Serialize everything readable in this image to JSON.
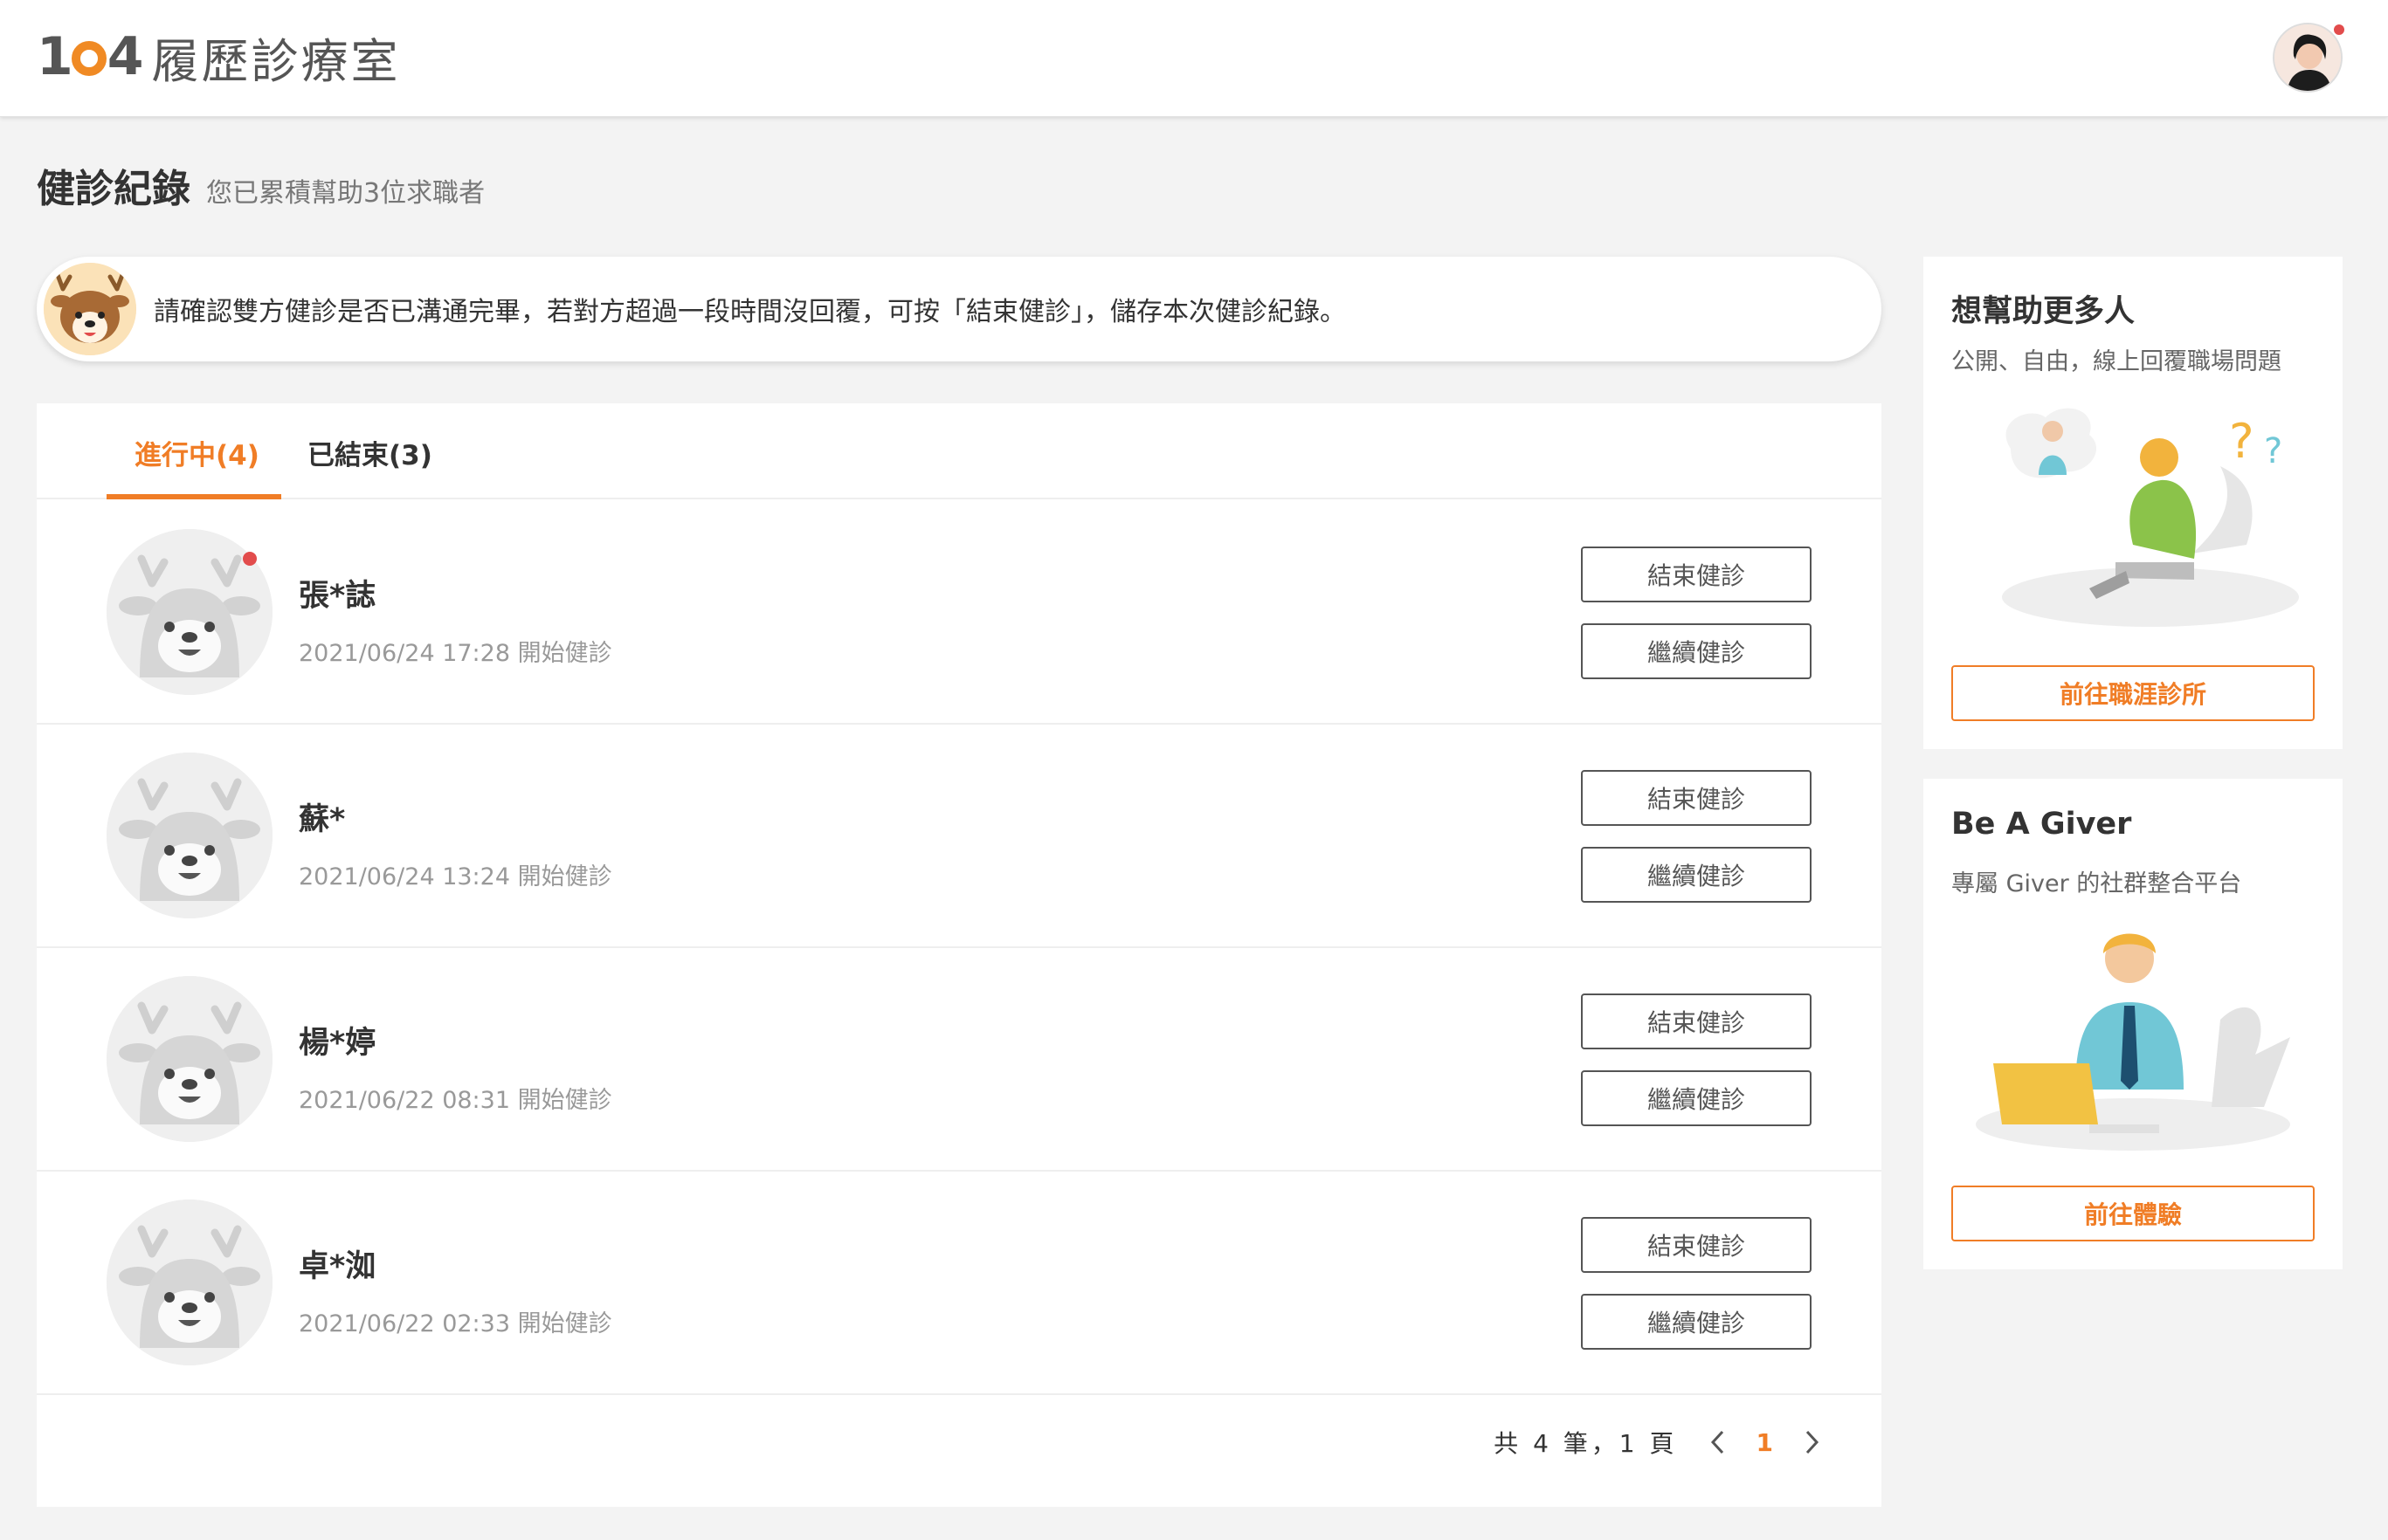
{
  "header": {
    "brand_number": "104",
    "brand_name": "履歷診療室"
  },
  "page": {
    "title": "健診紀錄",
    "subtitle": "您已累積幫助3位求職者"
  },
  "notice": {
    "text": "請確認雙方健診是否已溝通完畢，若對方超過一段時間沒回覆，可按「結束健診」，儲存本次健診紀錄。"
  },
  "tabs": {
    "active": "進行中(4)",
    "inactive": "已結束(3)"
  },
  "rows": [
    {
      "name": "張*誌",
      "meta": "2021/06/24 17:28 開始健診",
      "unread": true
    },
    {
      "name": "蘇*",
      "meta": "2021/06/24 13:24 開始健診",
      "unread": false
    },
    {
      "name": "楊*婷",
      "meta": "2021/06/22 08:31 開始健診",
      "unread": false
    },
    {
      "name": "卓*洳",
      "meta": "2021/06/22 02:33 開始健診",
      "unread": false
    }
  ],
  "buttons": {
    "end": "結束健診",
    "continue": "繼續健診"
  },
  "pagination": {
    "summary": "共 4 筆，1 頁",
    "current": "1",
    "prev_icon": "chevron-left-icon",
    "next_icon": "chevron-right-icon"
  },
  "sidebar": {
    "card1": {
      "title": "想幫助更多人",
      "desc": "公開、自由，線上回覆職場問題",
      "button": "前往職涯診所"
    },
    "card2": {
      "title": "Be A Giver",
      "desc": "專屬 Giver 的社群整合平台",
      "button": "前往體驗"
    }
  },
  "colors": {
    "accent": "#f07d26",
    "notification": "#e24c4c"
  }
}
